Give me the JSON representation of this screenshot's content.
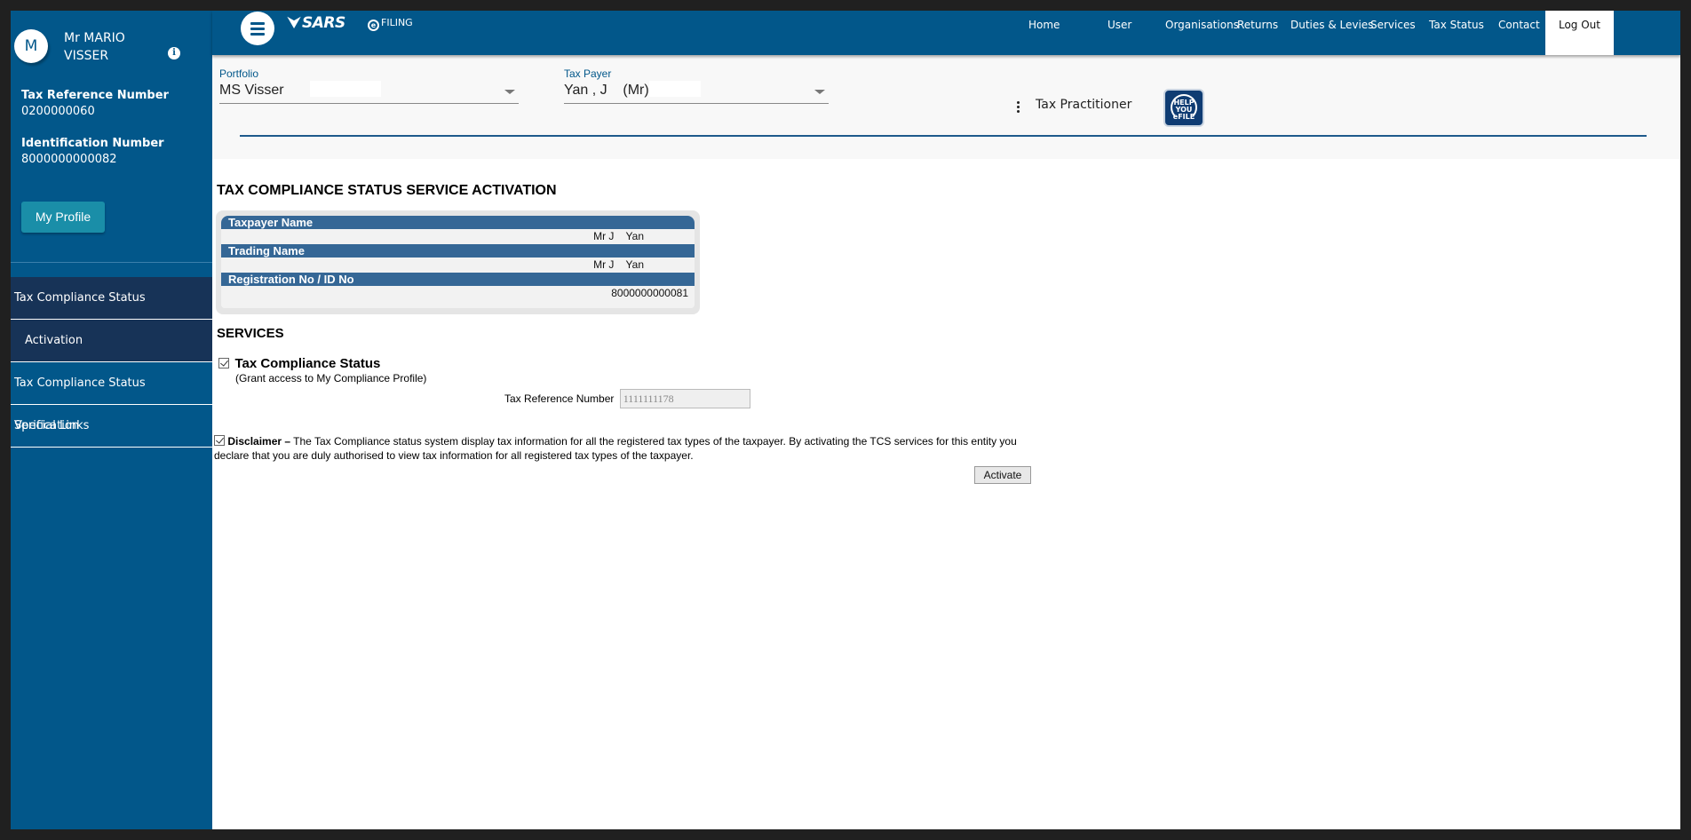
{
  "user": {
    "avatar_initial": "M",
    "name": "Mr MARIO VISSER",
    "tax_ref_label": "Tax Reference Number",
    "tax_ref_value": "0200000060",
    "id_label": "Identification Number",
    "id_value": "8000000000082",
    "profile_button": "My Profile"
  },
  "sidebar": {
    "items": [
      {
        "label": "Tax Compliance Status"
      },
      {
        "label": "Activation"
      },
      {
        "label": "Tax Compliance Status Verification"
      },
      {
        "label": "Special Links"
      }
    ]
  },
  "header": {
    "brand": "SARS",
    "product": "FILING",
    "nav": [
      "Home",
      "User",
      "Organisations",
      "Returns",
      "Duties & Levies",
      "Services",
      "Tax Status",
      "Contact",
      "Log Out"
    ]
  },
  "selector": {
    "portfolio_label": "Portfolio",
    "portfolio_value": "MS Visser",
    "taxpayer_label": "Tax Payer",
    "taxpayer_value": "Yan , J    (Mr)",
    "role": "Tax Practitioner",
    "help_badge": [
      "HELP",
      "YOU",
      "eFILE"
    ]
  },
  "main": {
    "title": "TAX COMPLIANCE STATUS SERVICE ACTIVATION",
    "info": [
      {
        "label": "Taxpayer Name",
        "value": "Mr J    Yan"
      },
      {
        "label": "Trading Name",
        "value": "Mr J    Yan"
      },
      {
        "label": "Registration No / ID No",
        "value": "8000000000081"
      }
    ],
    "services_title": "SERVICES",
    "service_name": "Tax Compliance Status",
    "service_checked": true,
    "service_sub": "(Grant access to My Compliance Profile)",
    "ref_label": "Tax Reference Number",
    "ref_value": "1111111178",
    "disclaimer_bold": "Disclaimer –",
    "disclaimer_text": " The Tax Compliance status system display tax information for all the registered tax types of the taxpayer. By activating the TCS services for this entity you declare that you are duly authorised to view tax information for all registered tax types of the taxpayer.",
    "disclaimer_checked": true,
    "activate_button": "Activate"
  }
}
